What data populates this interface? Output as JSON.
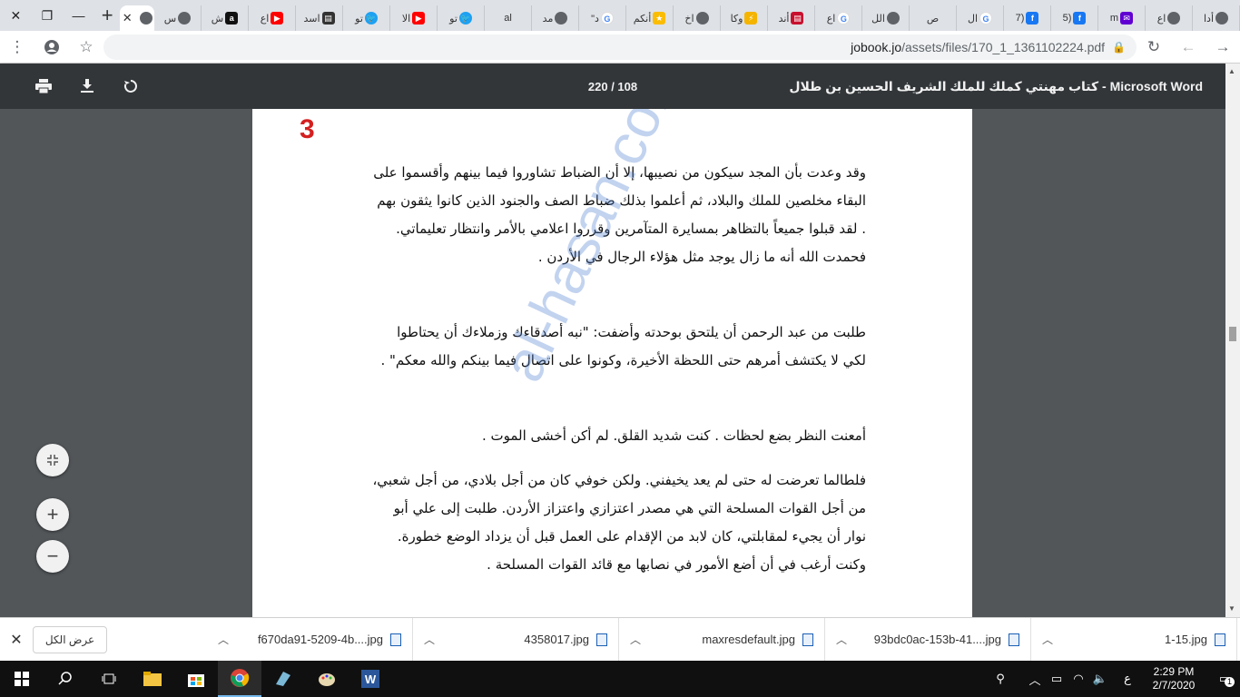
{
  "browser": {
    "tabs": [
      {
        "label": "أدا",
        "fav": "globe",
        "color": "#5f6368"
      },
      {
        "label": "اع",
        "fav": "globe",
        "color": "#5f6368"
      },
      {
        "label": "m",
        "fav": "yahoo",
        "color": "#6001d2"
      },
      {
        "label": "5)",
        "fav": "facebook",
        "color": "#1877f2"
      },
      {
        "label": "7)",
        "fav": "facebook",
        "color": "#1877f2"
      },
      {
        "label": "ال",
        "fav": "google",
        "color": "#4285f4"
      },
      {
        "label": "ص",
        "fav": "none",
        "color": "#ffffff"
      },
      {
        "label": "الل",
        "fav": "globe",
        "color": "#5f6368"
      },
      {
        "label": "اع",
        "fav": "google",
        "color": "#4285f4"
      },
      {
        "label": "أند",
        "fav": "news",
        "color": "#c8102e"
      },
      {
        "label": "وكا",
        "fav": "bolt",
        "color": "#f4b400"
      },
      {
        "label": "اخ",
        "fav": "globe",
        "color": "#5f6368"
      },
      {
        "label": "أنكم",
        "fav": "star",
        "color": "#fbbc04"
      },
      {
        "label": "\"د",
        "fav": "google",
        "color": "#4285f4"
      },
      {
        "label": "مد",
        "fav": "globe",
        "color": "#5f6368"
      },
      {
        "label": "al",
        "fav": "none",
        "color": "#ffffff"
      },
      {
        "label": "تو",
        "fav": "twitter",
        "color": "#1da1f2"
      },
      {
        "label": "الا",
        "fav": "youtube",
        "color": "#ff0000"
      },
      {
        "label": "تو",
        "fav": "twitter",
        "color": "#1da1f2"
      },
      {
        "label": "اسد",
        "fav": "news",
        "color": "#333333"
      },
      {
        "label": "اع",
        "fav": "youtube",
        "color": "#ff0000"
      },
      {
        "label": "ش",
        "fav": "dark",
        "color": "#111111"
      },
      {
        "label": "س",
        "fav": "globe",
        "color": "#5f6368"
      }
    ],
    "active_tab": {
      "fav": "globe",
      "close": "✕"
    },
    "new_tab": "+",
    "url_host": "jobook.jo",
    "url_path": "/assets/files/170_1_1361102224.pdf"
  },
  "pdf": {
    "title": "Microsoft Word - كتاب مهنتي كملك للملك الشريف الحسين بن طلال",
    "page_indicator": "220 / 108",
    "page_number": "3",
    "paragraphs": [
      {
        "lines": [
          "وقد وعدت بأن المجد سيكون من نصيبها، إلا أن الضباط تشاوروا فيما بينهم وأقسموا على",
          "البقاء مخلصين للملك والبلاد، ثم أعلموا بذلك ضباط الصف والجنود الذين كانوا يثقون بهم",
          ". لقد قبلوا جميعاً بالتظاهر بمسايرة المتآمرين وقرروا اعلامي بالأمر وانتظار تعليماتي.",
          "فحمدت الله أنه ما زال يوجد مثل هؤلاء الرجال في الأردن ."
        ]
      },
      {
        "lines": [
          "طلبت من عبد الرحمن أن يلتحق بوحدته وأضفت: \"نبه أصدقاءك وزملاءك أن يحتاطوا",
          "لكي لا يكتشف أمرهم حتى اللحظة الأخيرة، وكونوا على اتصال فيما بينكم والله معكم\" ."
        ]
      },
      {
        "lines": [
          "أمعنت النظر بضع لحظات . كنت شديد القلق. لم أكن أخشى الموت ."
        ]
      },
      {
        "lines": [
          "فلطالما تعرضت له حتى لم يعد يخيفني. ولكن خوفي كان من أجل بلادي، من أجل شعبي،",
          "من أجل القوات المسلحة التي هي مصدر اعتزازي واعتزاز الأردن. طلبت إلى علي أبو",
          "نوار أن يجيء لمقابلتي، كان لابد من الإقدام على العمل قبل أن يزداد الوضع خطورة.",
          "وكنت أرغب في أن أضع الأمور في نصابها مع قائد القوات المسلحة ."
        ]
      }
    ],
    "watermark": "al-hasan.com/vb"
  },
  "downloads": {
    "show_all": "عرض الكل",
    "items": [
      {
        "name": "f670da91-5209-4b....jpg"
      },
      {
        "name": "4358017.jpg"
      },
      {
        "name": "maxresdefault.jpg"
      },
      {
        "name": "93bdc0ac-153b-41....jpg"
      },
      {
        "name": "1-15.jpg"
      }
    ]
  },
  "taskbar": {
    "lang": "ع",
    "time": "2:29 PM",
    "date": "2/7/2020",
    "notifications": "1"
  }
}
